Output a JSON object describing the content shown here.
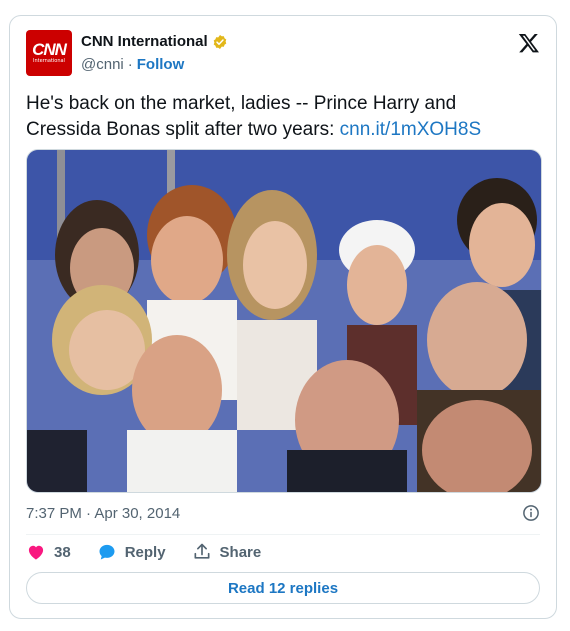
{
  "account": {
    "avatar_logo": "CNN",
    "avatar_sub": "International",
    "name": "CNN International",
    "handle": "@cnni",
    "separator": "·",
    "follow_label": "Follow"
  },
  "tweet": {
    "text": "He's back on the market, ladies -- Prince Harry and Cressida Bonas split after two years: ",
    "link": "cnn.it/1mXOH8S",
    "time": "7:37 PM · Apr 30, 2014"
  },
  "actions": {
    "likes": "38",
    "reply_label": "Reply",
    "share_label": "Share"
  },
  "read_replies_label": "Read 12 replies",
  "colors": {
    "link": "#1d77c3",
    "like": "#f91880",
    "brand": "#cc0000",
    "verified": "#e2b719"
  }
}
